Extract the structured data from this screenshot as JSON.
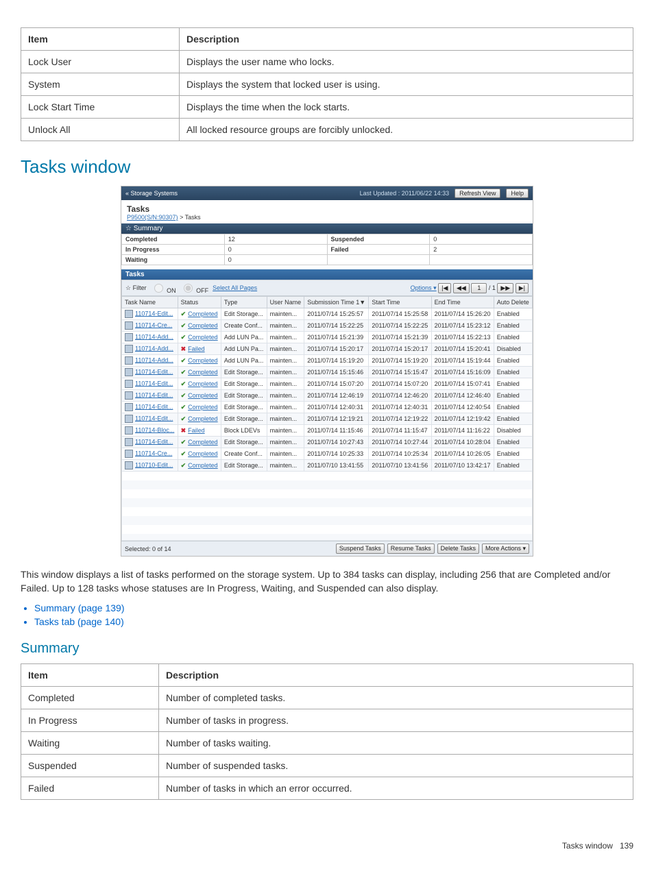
{
  "top_table": {
    "headers": [
      "Item",
      "Description"
    ],
    "rows": [
      [
        "Lock User",
        "Displays the user name who locks."
      ],
      [
        "System",
        "Displays the system that locked user is using."
      ],
      [
        "Lock Start Time",
        "Displays the time when the lock starts."
      ],
      [
        "Unlock All",
        "All locked resource groups are forcibly unlocked."
      ]
    ]
  },
  "h1": "Tasks window",
  "shot": {
    "back_link": "« Storage Systems",
    "last_updated_label": "Last Updated :",
    "last_updated_value": "2011/06/22 14:33",
    "refresh": "Refresh View",
    "help": "Help",
    "title": "Tasks",
    "crumbs_a": "P9500(S/N:90307)",
    "crumbs_b": " > Tasks",
    "summary_hdr": "Summary",
    "summary": {
      "completed_k": "Completed",
      "completed_v": "12",
      "suspended_k": "Suspended",
      "suspended_v": "0",
      "inprog_k": "In Progress",
      "inprog_v": "0",
      "failed_k": "Failed",
      "failed_v": "2",
      "waiting_k": "Waiting",
      "waiting_v": "0"
    },
    "tasks_tab": "Tasks",
    "filter_label": "☆ Filter",
    "filter_on": "ON",
    "filter_off": "OFF",
    "select_all": "Select All Pages",
    "options": "Options ▾",
    "page_first": "|◀",
    "page_prev": "◀◀",
    "page_cur": "1",
    "page_sep": "/ 1",
    "page_next": "▶▶",
    "page_last": "▶|",
    "cols": {
      "task": "Task Name",
      "status": "Status",
      "type": "Type",
      "user": "User Name",
      "subm": "Submission Time  1▼",
      "start": "Start Time",
      "end": "End Time",
      "auto": "Auto Delete"
    },
    "rows": [
      {
        "name": "110714-Edit...",
        "status": "Completed",
        "ok": true,
        "type": "Edit Storage...",
        "user": "mainten...",
        "s": "2011/07/14 15:25:57",
        "st": "2011/07/14 15:25:58",
        "e": "2011/07/14 15:26:20",
        "a": "Enabled"
      },
      {
        "name": "110714-Cre...",
        "status": "Completed",
        "ok": true,
        "type": "Create Conf...",
        "user": "mainten...",
        "s": "2011/07/14 15:22:25",
        "st": "2011/07/14 15:22:25",
        "e": "2011/07/14 15:23:12",
        "a": "Enabled"
      },
      {
        "name": "110714-Add...",
        "status": "Completed",
        "ok": true,
        "type": "Add LUN Pa...",
        "user": "mainten...",
        "s": "2011/07/14 15:21:39",
        "st": "2011/07/14 15:21:39",
        "e": "2011/07/14 15:22:13",
        "a": "Enabled"
      },
      {
        "name": "110714-Add...",
        "status": "Failed",
        "ok": false,
        "type": "Add LUN Pa...",
        "user": "mainten...",
        "s": "2011/07/14 15:20:17",
        "st": "2011/07/14 15:20:17",
        "e": "2011/07/14 15:20:41",
        "a": "Disabled"
      },
      {
        "name": "110714-Add...",
        "status": "Completed",
        "ok": true,
        "type": "Add LUN Pa...",
        "user": "mainten...",
        "s": "2011/07/14 15:19:20",
        "st": "2011/07/14 15:19:20",
        "e": "2011/07/14 15:19:44",
        "a": "Enabled"
      },
      {
        "name": "110714-Edit...",
        "status": "Completed",
        "ok": true,
        "type": "Edit Storage...",
        "user": "mainten...",
        "s": "2011/07/14 15:15:46",
        "st": "2011/07/14 15:15:47",
        "e": "2011/07/14 15:16:09",
        "a": "Enabled"
      },
      {
        "name": "110714-Edit...",
        "status": "Completed",
        "ok": true,
        "type": "Edit Storage...",
        "user": "mainten...",
        "s": "2011/07/14 15:07:20",
        "st": "2011/07/14 15:07:20",
        "e": "2011/07/14 15:07:41",
        "a": "Enabled"
      },
      {
        "name": "110714-Edit...",
        "status": "Completed",
        "ok": true,
        "type": "Edit Storage...",
        "user": "mainten...",
        "s": "2011/07/14 12:46:19",
        "st": "2011/07/14 12:46:20",
        "e": "2011/07/14 12:46:40",
        "a": "Enabled"
      },
      {
        "name": "110714-Edit...",
        "status": "Completed",
        "ok": true,
        "type": "Edit Storage...",
        "user": "mainten...",
        "s": "2011/07/14 12:40:31",
        "st": "2011/07/14 12:40:31",
        "e": "2011/07/14 12:40:54",
        "a": "Enabled"
      },
      {
        "name": "110714-Edit...",
        "status": "Completed",
        "ok": true,
        "type": "Edit Storage...",
        "user": "mainten...",
        "s": "2011/07/14 12:19:21",
        "st": "2011/07/14 12:19:22",
        "e": "2011/07/14 12:19:42",
        "a": "Enabled"
      },
      {
        "name": "110714-Bloc...",
        "status": "Failed",
        "ok": false,
        "type": "Block LDEVs",
        "user": "mainten...",
        "s": "2011/07/14 11:15:46",
        "st": "2011/07/14 11:15:47",
        "e": "2011/07/14 11:16:22",
        "a": "Disabled"
      },
      {
        "name": "110714-Edit...",
        "status": "Completed",
        "ok": true,
        "type": "Edit Storage...",
        "user": "mainten...",
        "s": "2011/07/14 10:27:43",
        "st": "2011/07/14 10:27:44",
        "e": "2011/07/14 10:28:04",
        "a": "Enabled"
      },
      {
        "name": "110714-Cre...",
        "status": "Completed",
        "ok": true,
        "type": "Create Conf...",
        "user": "mainten...",
        "s": "2011/07/14 10:25:33",
        "st": "2011/07/14 10:25:34",
        "e": "2011/07/14 10:26:05",
        "a": "Enabled"
      },
      {
        "name": "110710-Edit...",
        "status": "Completed",
        "ok": true,
        "type": "Edit Storage...",
        "user": "mainten...",
        "s": "2011/07/10 13:41:55",
        "st": "2011/07/10 13:41:56",
        "e": "2011/07/10 13:42:17",
        "a": "Enabled"
      }
    ],
    "selected": "Selected: 0  of 14",
    "suspend": "Suspend Tasks",
    "resume": "Resume Tasks",
    "delete": "Delete Tasks",
    "more": "More Actions ▾"
  },
  "para": "This window displays a list of tasks performed on the storage system. Up to 384 tasks can display, including 256 that are Completed and/or Failed. Up to 128 tasks whose statuses are In Progress, Waiting, and Suspended can also display.",
  "links": [
    "Summary (page 139)",
    "Tasks tab (page 140)"
  ],
  "h2": "Summary",
  "summary_table": {
    "headers": [
      "Item",
      "Description"
    ],
    "rows": [
      [
        "Completed",
        "Number of completed tasks."
      ],
      [
        "In Progress",
        "Number of tasks in progress."
      ],
      [
        "Waiting",
        "Number of tasks waiting."
      ],
      [
        "Suspended",
        "Number of suspended tasks."
      ],
      [
        "Failed",
        "Number of tasks in which an error occurred."
      ]
    ]
  },
  "footer_label": "Tasks window",
  "footer_page": "139"
}
